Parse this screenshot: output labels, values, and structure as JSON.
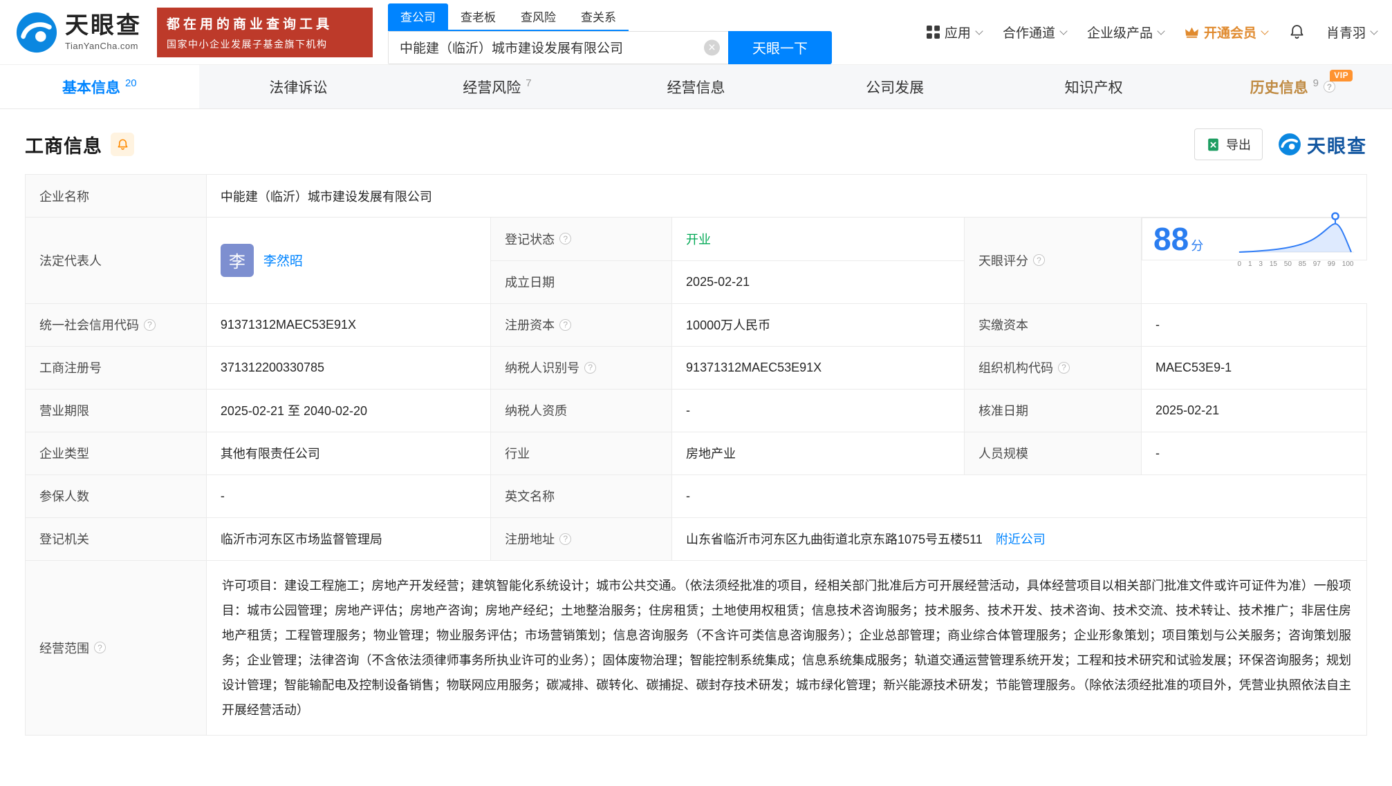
{
  "brand": {
    "name": "天眼查",
    "domain": "TianYanCha.com"
  },
  "header": {
    "banner": {
      "line1": "都在用的商业查询工具",
      "line2": "国家中小企业发展子基金旗下机构"
    },
    "search_tabs": [
      {
        "label": "查公司"
      },
      {
        "label": "查老板"
      },
      {
        "label": "查风险"
      },
      {
        "label": "查关系"
      }
    ],
    "search_value": "中能建（临沂）城市建设发展有限公司",
    "search_button": "天眼一下",
    "nav": [
      {
        "label": "应用"
      },
      {
        "label": "合作通道"
      },
      {
        "label": "企业级产品"
      },
      {
        "label": "开通会员"
      },
      {
        "label": "肖青羽"
      }
    ]
  },
  "tabs": [
    {
      "label": "基本信息",
      "count": "20"
    },
    {
      "label": "法律诉讼",
      "count": ""
    },
    {
      "label": "经营风险",
      "count": "7"
    },
    {
      "label": "经营信息",
      "count": ""
    },
    {
      "label": "公司发展",
      "count": ""
    },
    {
      "label": "知识产权",
      "count": ""
    },
    {
      "label": "历史信息",
      "count": "9",
      "vip": "VIP"
    }
  ],
  "section": {
    "title": "工商信息",
    "export": "导出",
    "brand": "天眼查"
  },
  "fields": {
    "company_name": {
      "label": "企业名称",
      "value": "中能建（临沂）城市建设发展有限公司"
    },
    "legal_rep": {
      "label": "法定代表人",
      "avatar": "李",
      "value": "李然昭"
    },
    "reg_status": {
      "label": "登记状态",
      "value": "开业"
    },
    "establish_date": {
      "label": "成立日期",
      "value": "2025-02-21"
    },
    "score": {
      "label": "天眼评分",
      "value": "88",
      "unit": "分",
      "axis": "0 1 3 15 50 85 97 99 100"
    },
    "credit_code": {
      "label": "统一社会信用代码",
      "value": "91371312MAEC53E91X"
    },
    "reg_capital": {
      "label": "注册资本",
      "value": "10000万人民币"
    },
    "paid_capital": {
      "label": "实缴资本",
      "value": "-"
    },
    "reg_number": {
      "label": "工商注册号",
      "value": "371312200330785"
    },
    "taxpayer_id": {
      "label": "纳税人识别号",
      "value": "91371312MAEC53E91X"
    },
    "org_code": {
      "label": "组织机构代码",
      "value": "MAEC53E9-1"
    },
    "business_term": {
      "label": "营业期限",
      "value": "2025-02-21 至 2040-02-20"
    },
    "taxpayer_quality": {
      "label": "纳税人资质",
      "value": "-"
    },
    "approval_date": {
      "label": "核准日期",
      "value": "2025-02-21"
    },
    "company_type": {
      "label": "企业类型",
      "value": "其他有限责任公司"
    },
    "industry": {
      "label": "行业",
      "value": "房地产业"
    },
    "staff_size": {
      "label": "人员规模",
      "value": "-"
    },
    "insured_count": {
      "label": "参保人数",
      "value": "-"
    },
    "english_name": {
      "label": "英文名称",
      "value": "-"
    },
    "reg_authority": {
      "label": "登记机关",
      "value": "临沂市河东区市场监督管理局"
    },
    "reg_address": {
      "label": "注册地址",
      "value": "山东省临沂市河东区九曲街道北京东路1075号五楼511",
      "link": "附近公司"
    },
    "business_scope": {
      "label": "经营范围",
      "value": "许可项目：建设工程施工；房地产开发经营；建筑智能化系统设计；城市公共交通。（依法须经批准的项目，经相关部门批准后方可开展经营活动，具体经营项目以相关部门批准文件或许可证件为准）一般项目：城市公园管理；房地产评估；房地产咨询；房地产经纪；土地整治服务；住房租赁；土地使用权租赁；信息技术咨询服务；技术服务、技术开发、技术咨询、技术交流、技术转让、技术推广；非居住房地产租赁；工程管理服务；物业管理；物业服务评估；市场营销策划；信息咨询服务（不含许可类信息咨询服务）；企业总部管理；商业综合体管理服务；企业形象策划；项目策划与公关服务；咨询策划服务；企业管理；法律咨询（不含依法须律师事务所执业许可的业务）；固体废物治理；智能控制系统集成；信息系统集成服务；轨道交通运营管理系统开发；工程和技术研究和试验发展；环保咨询服务；规划设计管理；智能输配电及控制设备销售；物联网应用服务；碳减排、碳转化、碳捕捉、碳封存技术研发；城市绿化管理；新兴能源技术研发；节能管理服务。（除依法须经批准的项目外，凭营业执照依法自主开展经营活动）"
    }
  },
  "colors": {
    "accent_blue": "#0084ff",
    "status_green": "#00a854",
    "banner_red": "#bd3a2a",
    "vip_orange": "#ff9330",
    "history_gold": "#bf8a42"
  }
}
